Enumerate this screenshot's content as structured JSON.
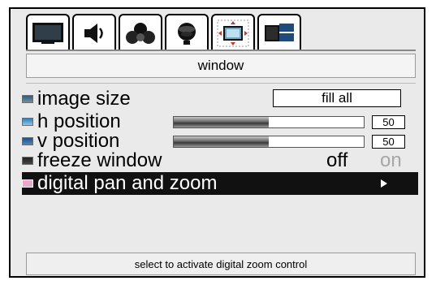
{
  "tabs": [
    {
      "icon": "picture-tab-icon"
    },
    {
      "icon": "audio-tab-icon"
    },
    {
      "icon": "channels-tab-icon"
    },
    {
      "icon": "setup-tab-icon"
    },
    {
      "icon": "window-tab-icon",
      "active": true
    },
    {
      "icon": "pip-tab-icon"
    }
  ],
  "section": {
    "title": "window"
  },
  "menu": {
    "image_size": {
      "label": "image size",
      "value": "fill all"
    },
    "h_position": {
      "label": "h position",
      "value": "50",
      "level": 0.5
    },
    "v_position": {
      "label": "v position",
      "value": "50",
      "level": 0.5
    },
    "freeze_window": {
      "label": "freeze window",
      "off": "off",
      "on": "on",
      "selected": "off"
    },
    "digital_pan_zoom": {
      "label": "digital pan and zoom",
      "selected": true
    }
  },
  "status": {
    "text": "select to activate digital zoom control"
  },
  "colors": {
    "selection": "#111111",
    "panel": "#eaeaea",
    "inactive_option": "#a7a7a7"
  }
}
